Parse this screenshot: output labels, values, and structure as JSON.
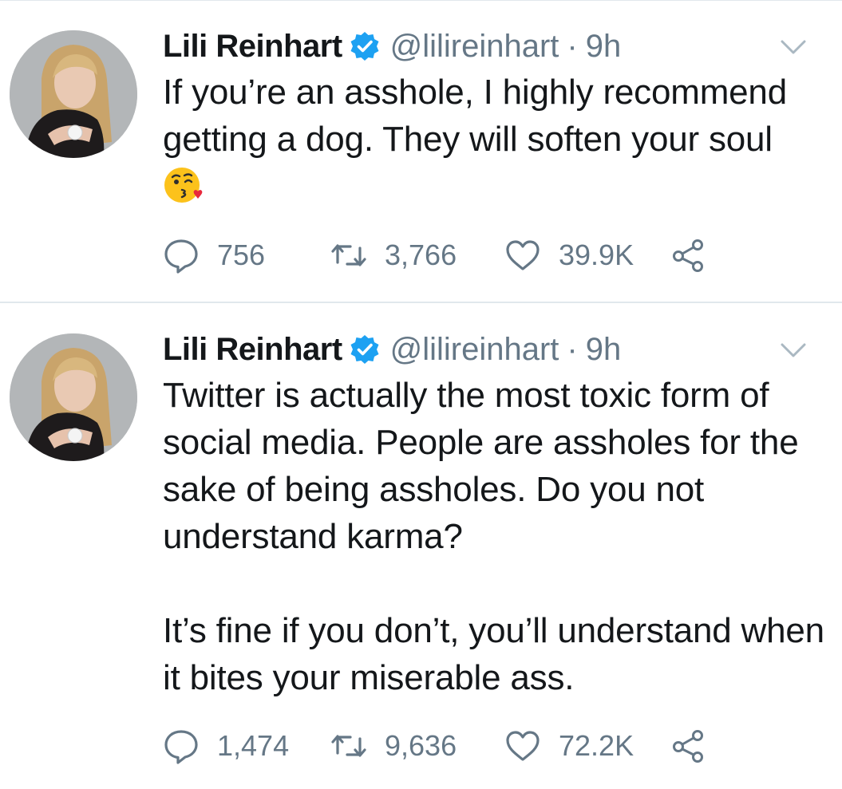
{
  "colors": {
    "text": "#14171a",
    "secondary": "#657786",
    "verified": "#1da1f2",
    "divider": "#e1e8ed"
  },
  "tweets": [
    {
      "author_name": "Lili Reinhart",
      "handle": "@lilireinhart",
      "separator": "·",
      "time": "9h",
      "text": "If you’re an asshole, I highly recommend getting a dog. They will soften your soul",
      "emoji": "face-blowing-a-kiss",
      "replies": "756",
      "retweets": "3,766",
      "likes": "39.9K"
    },
    {
      "author_name": "Lili Reinhart",
      "handle": "@lilireinhart",
      "separator": "·",
      "time": "9h",
      "text": "Twitter is actually the most toxic form of social media. People are assholes for the sake of being assholes. Do you not understand karma?\n\nIt’s fine if you don’t, you’ll understand when it bites your miserable ass.",
      "replies": "1,474",
      "retweets": "9,636",
      "likes": "72.2K"
    }
  ],
  "icons": {
    "reply": "reply-icon",
    "retweet": "retweet-icon",
    "like": "heart-icon",
    "share": "share-icon",
    "verified": "verified-badge-icon",
    "caret": "chevron-down-icon"
  }
}
